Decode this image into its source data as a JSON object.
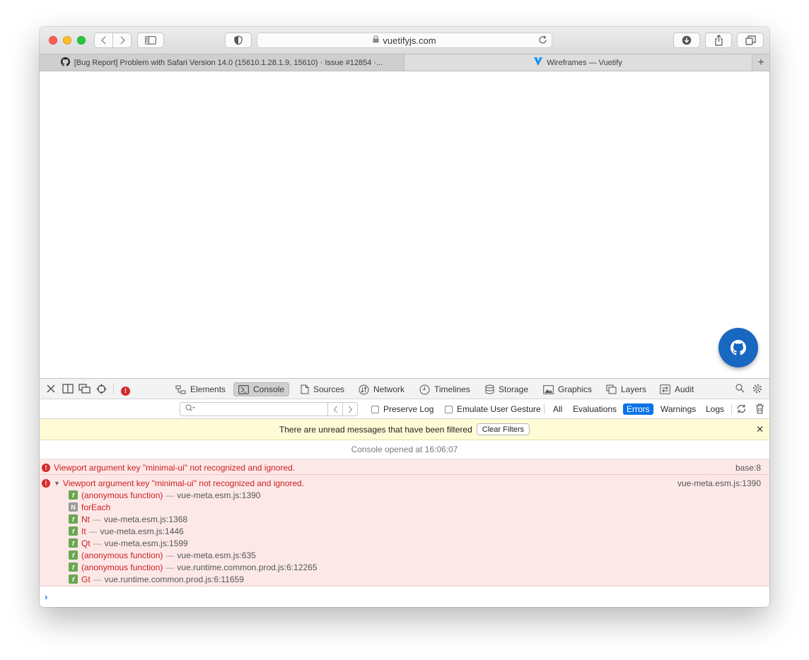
{
  "browser": {
    "url": "vuetifyjs.com",
    "tabs": [
      {
        "label": "[Bug Report] Problem with Safari Version 14.0 (15610.1.28.1.9, 15610) · Issue #12854 ·...",
        "icon": "github-icon"
      },
      {
        "label": "Wireframes — Vuetify",
        "icon": "vuetify-icon"
      }
    ],
    "new_tab": "+"
  },
  "devtools": {
    "tabs": [
      {
        "label": "Elements"
      },
      {
        "label": "Console"
      },
      {
        "label": "Sources"
      },
      {
        "label": "Network"
      },
      {
        "label": "Timelines"
      },
      {
        "label": "Storage"
      },
      {
        "label": "Graphics"
      },
      {
        "label": "Layers"
      },
      {
        "label": "Audit"
      }
    ],
    "active_tab": "Console",
    "filter": {
      "search_value": "",
      "preserve_log": "Preserve Log",
      "emulate_gesture": "Emulate User Gesture",
      "levels": [
        "All",
        "Evaluations",
        "Errors",
        "Warnings",
        "Logs"
      ],
      "active_level": "Errors"
    },
    "banner": {
      "text": "There are unread messages that have been filtered",
      "button": "Clear Filters",
      "close": "✕"
    },
    "opened_text": "Console opened at 16:06:07",
    "messages": [
      {
        "text": "Viewport argument key \"minimal-ui\" not recognized and ignored.",
        "source": "base:8"
      },
      {
        "text": "Viewport argument key \"minimal-ui\" not recognized and ignored.",
        "source": "vue-meta.esm.js:1390"
      }
    ],
    "stack": [
      {
        "badge": "f",
        "fn": "(anonymous function)",
        "loc": "vue-meta.esm.js:1390"
      },
      {
        "badge": "N",
        "fn": "forEach",
        "loc": ""
      },
      {
        "badge": "f",
        "fn": "Nt",
        "loc": "vue-meta.esm.js:1368"
      },
      {
        "badge": "f",
        "fn": "It",
        "loc": "vue-meta.esm.js:1446"
      },
      {
        "badge": "f",
        "fn": "Qt",
        "loc": "vue-meta.esm.js:1599"
      },
      {
        "badge": "f",
        "fn": "(anonymous function)",
        "loc": "vue-meta.esm.js:635"
      },
      {
        "badge": "f",
        "fn": "(anonymous function)",
        "loc": "vue.runtime.common.prod.js:6:12265"
      },
      {
        "badge": "f",
        "fn": "Gt",
        "loc": "vue.runtime.common.prod.js:6:11659"
      }
    ],
    "dash": "—",
    "prompt": "›"
  }
}
